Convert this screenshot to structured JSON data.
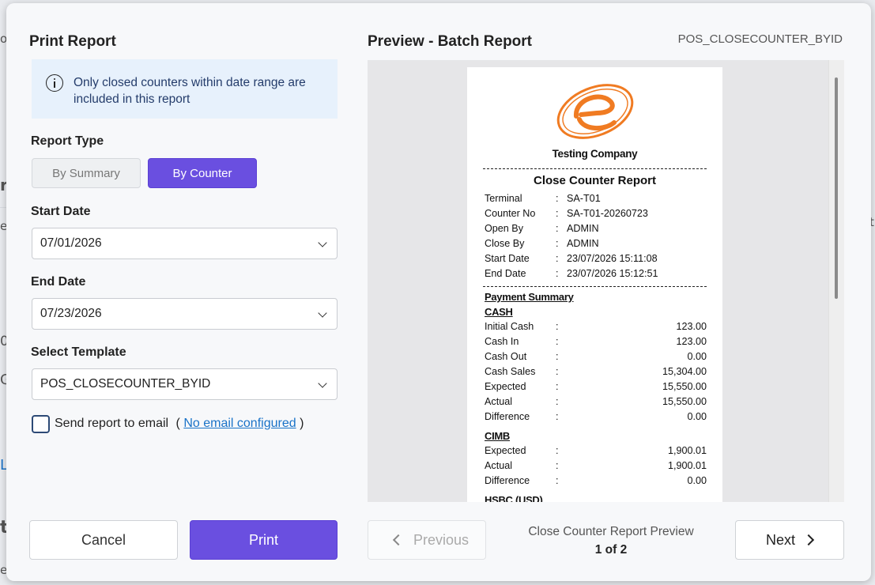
{
  "background": {
    "fragments": [
      "o",
      "?",
      "r",
      "e",
      "0)",
      "G",
      "L",
      "t",
      "t",
      "e"
    ]
  },
  "left": {
    "title": "Print Report",
    "info_text": "Only closed counters within date range are included in this report",
    "report_type_label": "Report Type",
    "report_types": [
      "By Summary",
      "By Counter"
    ],
    "selected_report_type": "By Counter",
    "start_date_label": "Start Date",
    "start_date": "07/01/2026",
    "end_date_label": "End Date",
    "end_date": "07/23/2026",
    "template_label": "Select Template",
    "template_value": "POS_CLOSECOUNTER_BYID",
    "email_label": "Send report to email",
    "email_open": "(",
    "email_link": "No email configured",
    "email_close": ")",
    "email_checked": false,
    "cancel_label": "Cancel",
    "print_label": "Print"
  },
  "right": {
    "title": "Preview - Batch Report",
    "template_code": "POS_CLOSECOUNTER_BYID",
    "previous_label": "Previous",
    "next_label": "Next",
    "caption": "Close Counter Report Preview",
    "page_indicator": "1 of 2"
  },
  "report": {
    "company": "Testing Company",
    "title": "Close Counter Report",
    "header_rows": [
      {
        "key": "Terminal",
        "value": "SA-T01"
      },
      {
        "key": "Counter No",
        "value": "SA-T01-20260723"
      },
      {
        "key": "Open By",
        "value": "ADMIN"
      },
      {
        "key": "Close By",
        "value": "ADMIN"
      },
      {
        "key": "Start Date",
        "value": "23/07/2026 15:11:08"
      },
      {
        "key": "End Date",
        "value": "23/07/2026 15:12:51"
      }
    ],
    "payment_summary_label": "Payment Summary",
    "colon": ":",
    "sections": [
      {
        "name": "CASH",
        "rows": [
          {
            "key": "Initial Cash",
            "value": "123.00"
          },
          {
            "key": "Cash In",
            "value": "123.00"
          },
          {
            "key": "Cash Out",
            "value": "0.00"
          },
          {
            "key": "Cash Sales",
            "value": "15,304.00"
          },
          {
            "key": "Expected",
            "value": "15,550.00"
          },
          {
            "key": "Actual",
            "value": "15,550.00"
          },
          {
            "key": "Difference",
            "value": "0.00"
          }
        ]
      },
      {
        "name": "CIMB",
        "rows": [
          {
            "key": "Expected",
            "value": "1,900.01"
          },
          {
            "key": "Actual",
            "value": "1,900.01"
          },
          {
            "key": "Difference",
            "value": "0.00"
          }
        ]
      },
      {
        "name": "HSBC (USD)",
        "rows": []
      }
    ]
  },
  "colors": {
    "accent": "#6a4fe0",
    "logo": "#f07b22",
    "info_bg": "#e7f1fc",
    "link": "#1a73c8"
  },
  "icons": [
    "info-icon",
    "chevron-down-icon",
    "chevron-left-icon",
    "chevron-right-icon",
    "company-logo-icon"
  ]
}
